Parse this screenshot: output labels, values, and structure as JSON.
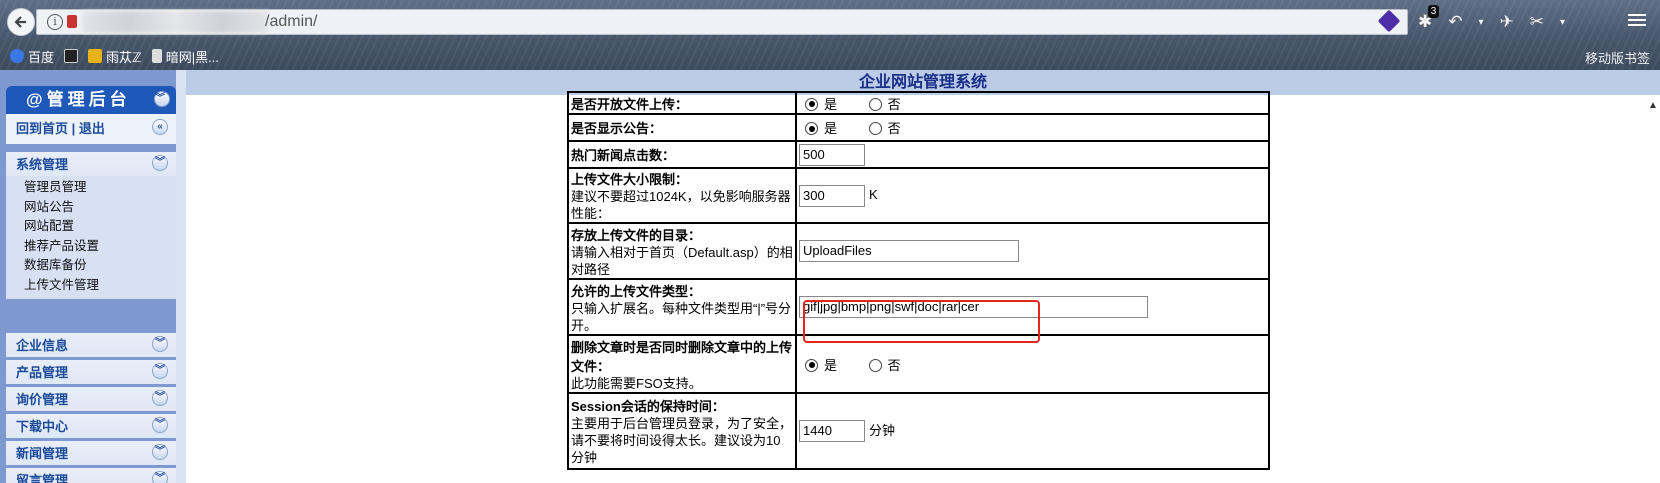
{
  "browser": {
    "url_suffix": "/admin/",
    "notification_badge": "3",
    "bookmarks": [
      {
        "label": "百度",
        "icon": "paw-icon"
      },
      {
        "label": "",
        "icon": "triangle-icon"
      },
      {
        "label": "雨苁ℤ",
        "icon": "shield-icon"
      },
      {
        "label": "暗网|黑...",
        "icon": "page-icon"
      }
    ],
    "mobile_bookmarks": "移动版书签"
  },
  "sidebar": {
    "title": "@管理后台",
    "links": "回到首页 | 退出",
    "system_section": "系统管理",
    "system_items": [
      "管理员管理",
      "网站公告",
      "网站配置",
      "推荐产品设置",
      "数据库备份",
      "上传文件管理"
    ],
    "sections": [
      "企业信息",
      "产品管理",
      "询价管理",
      "下载中心",
      "新闻管理",
      "留言管理"
    ]
  },
  "header": {
    "title": "企业网站管理系统"
  },
  "form": {
    "radio_yes": "是",
    "radio_no": "否",
    "rows": {
      "upload_enable": {
        "label": "是否开放文件上传："
      },
      "show_notice": {
        "label": "是否显示公告："
      },
      "hot_clicks": {
        "label": "热门新闻点击数：",
        "value": "500"
      },
      "upload_size": {
        "label": "上传文件大小限制：",
        "desc": "建议不要超过1024K，以免影响服务器性能：",
        "value": "300",
        "unit": "K"
      },
      "upload_dir": {
        "label": "存放上传文件的目录：",
        "desc": "请输入相对于首页（Default.asp）的相对路径",
        "value": "UploadFiles"
      },
      "file_types": {
        "label": "允许的上传文件类型：",
        "desc": "只输入扩展名。每种文件类型用“|”号分开。",
        "value": "gif|jpg|bmp|png|swf|doc|rar|cer"
      },
      "delete_files": {
        "label": "删除文章时是否同时删除文章中的上传文件：",
        "desc": "此功能需要FSO支持。"
      },
      "session_timeout": {
        "label": "Session会话的保持时间：",
        "desc": "主要用于后台管理员登录，为了安全，请不要将时间设得太长。建议设为10分钟",
        "value": "1440",
        "unit": "分钟"
      }
    }
  }
}
